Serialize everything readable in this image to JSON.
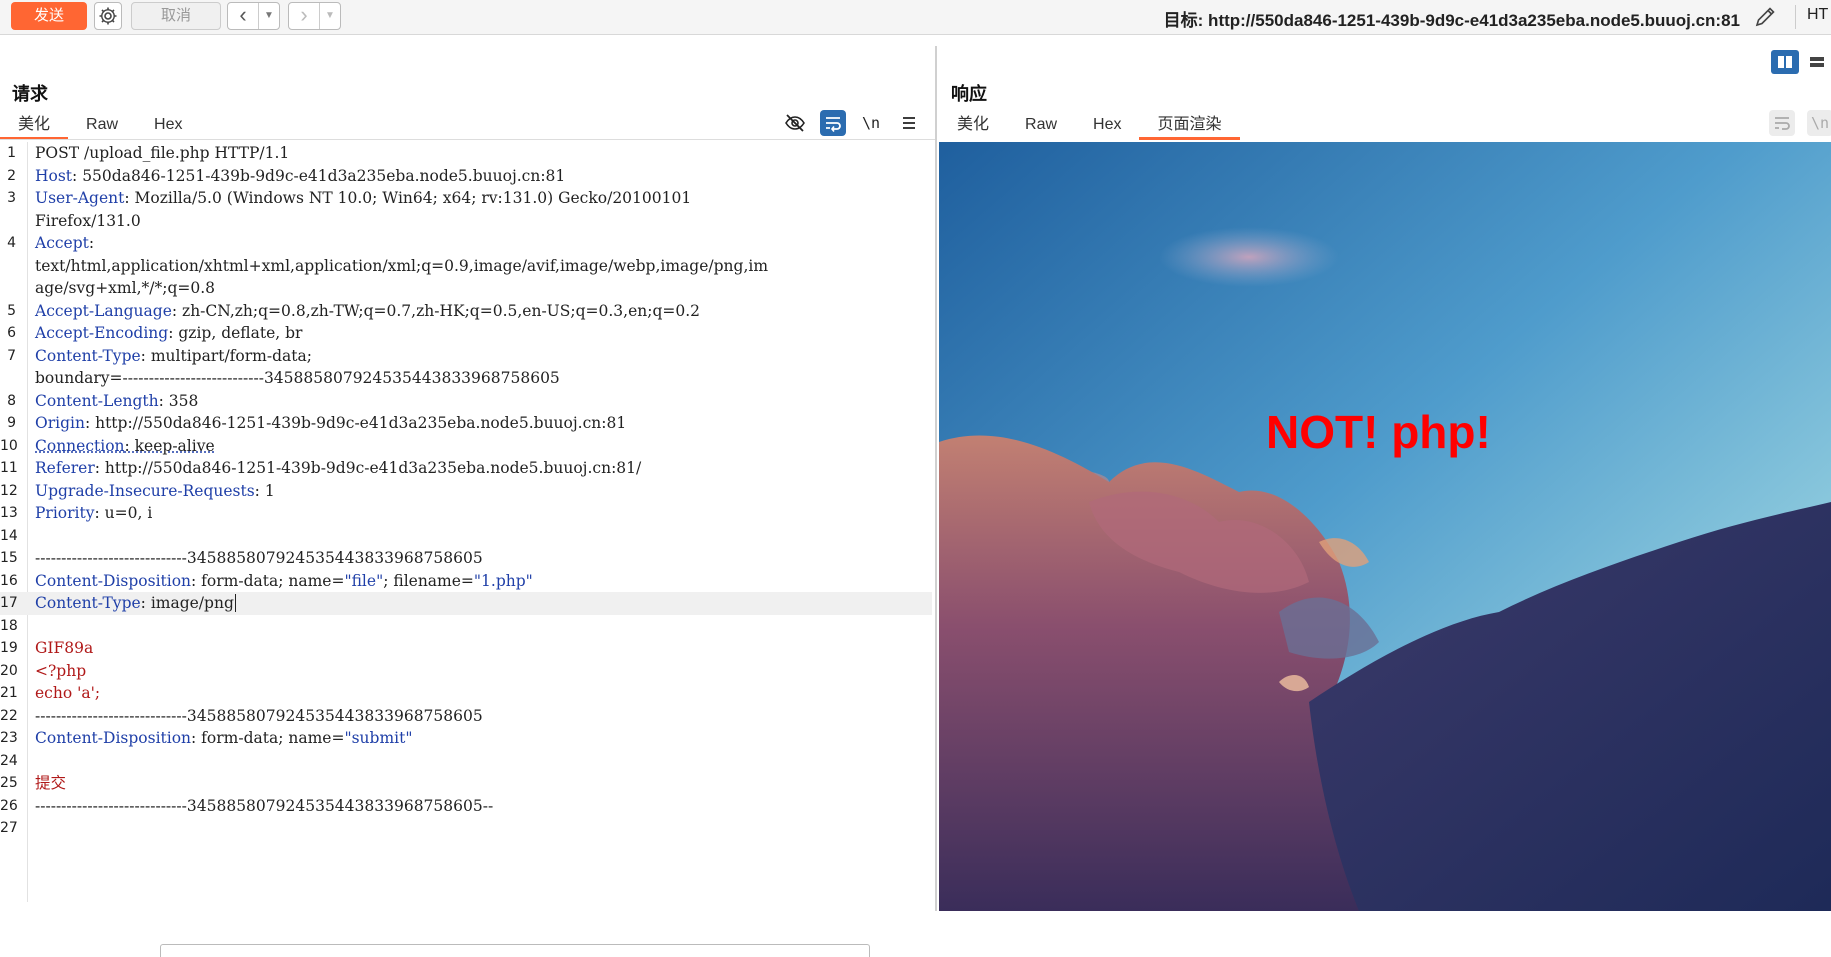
{
  "toolbar": {
    "send_label": "发送",
    "cancel_label": "取消",
    "target_text": "目标: http://550da846-1251-439b-9d9c-e41d3a235eba.node5.buuoj.cn:81",
    "right_text": "HT"
  },
  "request": {
    "title": "请求",
    "tabs": [
      "美化",
      "Raw",
      "Hex"
    ],
    "active_tab": "美化",
    "lines": [
      {
        "n": "1",
        "parts": [
          [
            "",
            "POST /upload_file.php HTTP/1.1"
          ]
        ]
      },
      {
        "n": "2",
        "parts": [
          [
            "k",
            "Host"
          ],
          [
            "",
            ": 550da846-1251-439b-9d9c-e41d3a235eba.node5.buuoj.cn:81"
          ]
        ]
      },
      {
        "n": "3",
        "parts": [
          [
            "k",
            "User-Agent"
          ],
          [
            "",
            ": Mozilla/5.0 (Windows NT 10.0; Win64; x64; rv:131.0) Gecko/20100101"
          ]
        ]
      },
      {
        "n": "",
        "parts": [
          [
            "",
            "Firefox/131.0"
          ]
        ]
      },
      {
        "n": "4",
        "parts": [
          [
            "k",
            "Accept"
          ],
          [
            "",
            ":"
          ]
        ]
      },
      {
        "n": "",
        "parts": [
          [
            "",
            "text/html,application/xhtml+xml,application/xml;q=0.9,image/avif,image/webp,image/png,im"
          ]
        ]
      },
      {
        "n": "",
        "parts": [
          [
            "",
            "age/svg+xml,*/*;q=0.8"
          ]
        ]
      },
      {
        "n": "5",
        "parts": [
          [
            "k",
            "Accept-Language"
          ],
          [
            "",
            ": zh-CN,zh;q=0.8,zh-TW;q=0.7,zh-HK;q=0.5,en-US;q=0.3,en;q=0.2"
          ]
        ]
      },
      {
        "n": "6",
        "parts": [
          [
            "k",
            "Accept-Encoding"
          ],
          [
            "",
            ": gzip, deflate, br"
          ]
        ]
      },
      {
        "n": "7",
        "parts": [
          [
            "k",
            "Content-Type"
          ],
          [
            "",
            ": multipart/form-data;"
          ]
        ]
      },
      {
        "n": "",
        "parts": [
          [
            "",
            "boundary=---------------------------345885807924535443833968758605"
          ]
        ]
      },
      {
        "n": "8",
        "parts": [
          [
            "k",
            "Content-Length"
          ],
          [
            "",
            ": 358"
          ]
        ]
      },
      {
        "n": "9",
        "parts": [
          [
            "k",
            "Origin"
          ],
          [
            "",
            ": http://550da846-1251-439b-9d9c-e41d3a235eba.node5.buuoj.cn:81"
          ]
        ]
      },
      {
        "n": "10",
        "parts": [
          [
            "ku",
            "Connection"
          ],
          [
            "u",
            ": keep-alive"
          ]
        ]
      },
      {
        "n": "11",
        "parts": [
          [
            "k",
            "Referer"
          ],
          [
            "",
            ": http://550da846-1251-439b-9d9c-e41d3a235eba.node5.buuoj.cn:81/"
          ]
        ]
      },
      {
        "n": "12",
        "parts": [
          [
            "k",
            "Upgrade-Insecure-Requests"
          ],
          [
            "",
            ": 1"
          ]
        ]
      },
      {
        "n": "13",
        "parts": [
          [
            "k",
            "Priority"
          ],
          [
            "",
            ": u=0, i"
          ]
        ]
      },
      {
        "n": "14",
        "parts": []
      },
      {
        "n": "15",
        "parts": [
          [
            "",
            "-----------------------------345885807924535443833968758605"
          ]
        ]
      },
      {
        "n": "16",
        "parts": [
          [
            "k",
            "Content-Disposition"
          ],
          [
            "",
            ": form-data; name="
          ],
          [
            "s",
            "\"file\""
          ],
          [
            "",
            "; filename="
          ],
          [
            "s",
            "\"1.php\""
          ]
        ]
      },
      {
        "n": "17",
        "parts": [
          [
            "k",
            "Content-Type"
          ],
          [
            "",
            ": image/png"
          ]
        ],
        "highlight": true
      },
      {
        "n": "18",
        "parts": []
      },
      {
        "n": "19",
        "parts": [
          [
            "r",
            "GIF89a"
          ]
        ]
      },
      {
        "n": "20",
        "parts": [
          [
            "r",
            "<?php"
          ]
        ]
      },
      {
        "n": "21",
        "parts": [
          [
            "r",
            "echo 'a';"
          ]
        ]
      },
      {
        "n": "22",
        "parts": [
          [
            "",
            "-----------------------------345885807924535443833968758605"
          ]
        ]
      },
      {
        "n": "23",
        "parts": [
          [
            "k",
            "Content-Disposition"
          ],
          [
            "",
            ": form-data; name="
          ],
          [
            "s",
            "\"submit\""
          ]
        ]
      },
      {
        "n": "24",
        "parts": []
      },
      {
        "n": "25",
        "parts": [
          [
            "r",
            "提交"
          ]
        ]
      },
      {
        "n": "26",
        "parts": [
          [
            "",
            "-----------------------------345885807924535443833968758605--"
          ]
        ]
      },
      {
        "n": "27",
        "parts": []
      }
    ]
  },
  "response": {
    "title": "响应",
    "tabs": [
      "美化",
      "Raw",
      "Hex",
      "页面渲染"
    ],
    "active_tab": "页面渲染",
    "render_text": "NOT! php!"
  },
  "colors": {
    "accent": "#ff6633",
    "header_key": "#1f3fa8",
    "body_red": "#b01818",
    "render_text": "#ff0000",
    "selected_icon": "#2b6cb0"
  }
}
